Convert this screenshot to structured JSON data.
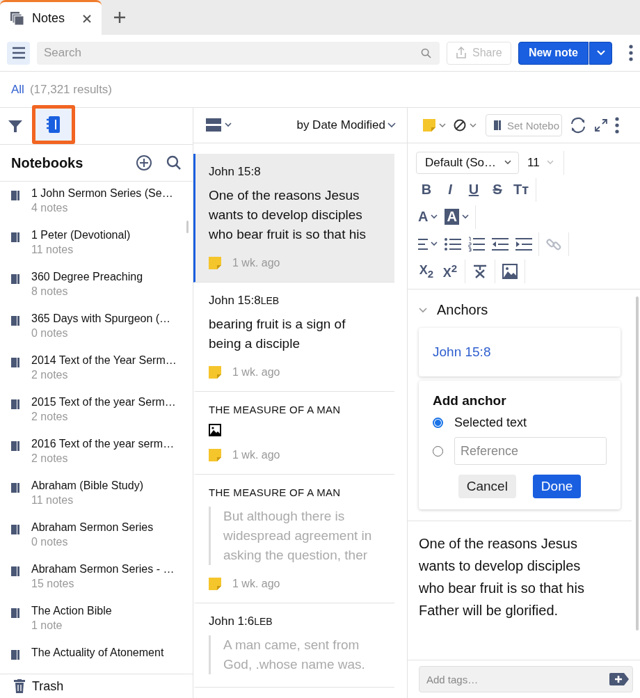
{
  "tab": {
    "title": "Notes",
    "selected": true
  },
  "toolbar": {
    "search_placeholder": "Search",
    "share": "Share",
    "new_note": "New note"
  },
  "results": {
    "filter": "All",
    "count": "(17,321 results)"
  },
  "sidebar": {
    "notebook_view_selected": true,
    "heading": "Notebooks",
    "trash": "Trash",
    "items": [
      {
        "name": "1 John Sermon Series (Se…",
        "count": "4 notes"
      },
      {
        "name": "1 Peter (Devotional)",
        "count": "11 notes"
      },
      {
        "name": "360 Degree Preaching",
        "count": "8 notes"
      },
      {
        "name": "365 Days with Spurgeon (…",
        "count": "0 notes"
      },
      {
        "name": "2014 Text of the Year Serm…",
        "count": "2 notes"
      },
      {
        "name": "2015 Text of the year Serm…",
        "count": "2 notes"
      },
      {
        "name": "2016 Text of the year serm…",
        "count": "2 notes"
      },
      {
        "name": "Abraham (Bible Study)",
        "count": "11 notes"
      },
      {
        "name": "Abraham Sermon Series",
        "count": "0 notes"
      },
      {
        "name": "Abraham Sermon Series - …",
        "count": "15 notes"
      },
      {
        "name": "The Action Bible",
        "count": "1 note"
      },
      {
        "name": "The Actuality of Atonement"
      }
    ]
  },
  "notes": {
    "sort": "by Date Modified",
    "items": [
      {
        "kind": "text",
        "title": "John 15:8",
        "preview": "One of the reasons Jesus wants to develop disciples who bear fruit is so that his",
        "time": "1 wk. ago",
        "selected": true
      },
      {
        "kind": "text",
        "title": "John 15:8",
        "version": "LEB",
        "preview": "bearing fruit is a sign of being a disciple",
        "time": "1 wk. ago",
        "selected": false
      },
      {
        "kind": "image",
        "title": "THE MEASURE OF A MAN",
        "time": "1 wk. ago",
        "selected": false
      },
      {
        "kind": "quote",
        "title": "THE MEASURE OF A MAN",
        "preview": "But although there is widespread agreement in asking the question, ther",
        "time": "1 wk. ago",
        "selected": false
      },
      {
        "kind": "quote",
        "title": "John 1:6",
        "version": "LEB",
        "preview": "A man came, sent from God, .whose name was.",
        "selected": false
      }
    ]
  },
  "editor": {
    "notebook_placeholder": "Set Notebo",
    "font": "Default (So…",
    "size": "11",
    "rows": [
      [
        [
          {
            "kind": "bold",
            "label": "B",
            "disabled": false
          },
          {
            "kind": "italic",
            "label": "I",
            "disabled": false
          },
          {
            "kind": "underline",
            "label": "U",
            "disabled": false
          },
          {
            "kind": "strike",
            "label": "S",
            "disabled": false
          },
          {
            "kind": "case",
            "label": "Tт",
            "disabled": false
          }
        ]
      ],
      [
        [
          {
            "kind": "color",
            "label": "A",
            "disabled": false
          },
          {
            "kind": "highlight",
            "label": "A",
            "disabled": false
          }
        ]
      ],
      [
        [
          {
            "kind": "align",
            "disabled": false
          },
          {
            "kind": "bullets",
            "disabled": false
          },
          {
            "kind": "numbers",
            "disabled": false
          },
          {
            "kind": "outdent",
            "disabled": false
          },
          {
            "kind": "indent",
            "disabled": false
          }
        ],
        [
          {
            "kind": "link",
            "disabled": true
          }
        ]
      ],
      [
        [
          {
            "kind": "sub",
            "label": "X$_{2}$",
            "disabled": false
          },
          {
            "kind": "sup",
            "label": "X$^{2}$",
            "disabled": false
          }
        ],
        [
          {
            "kind": "clear",
            "disabled": false
          }
        ],
        [
          {
            "kind": "image",
            "disabled": false
          }
        ]
      ]
    ],
    "anchors": {
      "title": "Anchors",
      "expanded": true,
      "items": [
        "John 15:8"
      ],
      "add": {
        "title": "Add anchor",
        "options": [
          {
            "kind": "text",
            "label": "Selected text",
            "selected": true
          },
          {
            "kind": "field",
            "placeholder": "Reference",
            "selected": false
          }
        ],
        "cancel": "Cancel",
        "done": "Done"
      }
    },
    "body": "One of the reasons Jesus wants to develop disciples who bear fruit is so that his Father will be glorified.",
    "tags_placeholder": "Add tags…"
  }
}
